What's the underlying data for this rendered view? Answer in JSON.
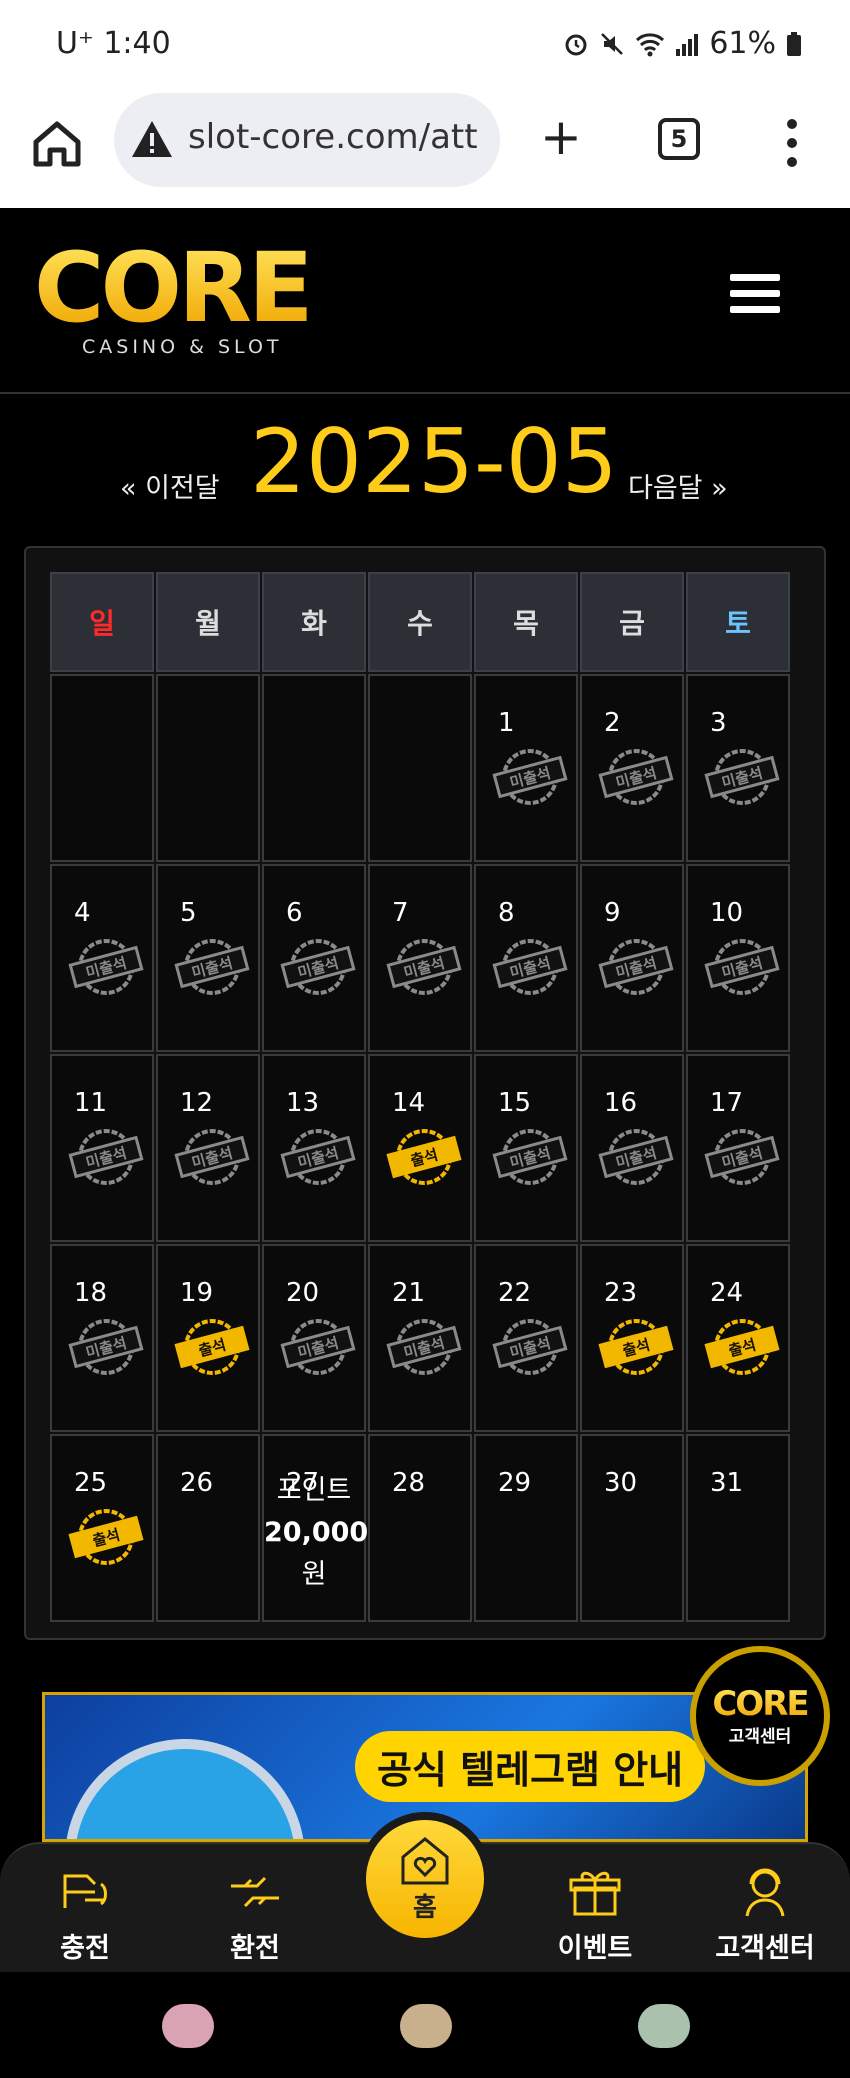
{
  "status": {
    "carrier_time": "U⁺ 1:40",
    "battery": "61%"
  },
  "browser": {
    "url": "slot-core.com/att",
    "tab_count": "5"
  },
  "site": {
    "logo_text": "CORE",
    "logo_sub": "CASINO & SLOT",
    "prev_label": "« 이전달",
    "month": "2025-05",
    "next_label": "다음달 »"
  },
  "calendar": {
    "weekdays": [
      "일",
      "월",
      "화",
      "수",
      "목",
      "금",
      "토"
    ],
    "weekday_colors": [
      "#ff2a2a",
      "#dddddd",
      "#dddddd",
      "#dddddd",
      "#dddddd",
      "#dddddd",
      "#6cc3ff"
    ],
    "stamp_labels": {
      "absent": "미출석",
      "present": "출석"
    },
    "weeks": [
      [
        null,
        null,
        null,
        null,
        {
          "day": "1",
          "status": "absent"
        },
        {
          "day": "2",
          "status": "absent"
        },
        {
          "day": "3",
          "status": "absent"
        }
      ],
      [
        {
          "day": "4",
          "status": "absent"
        },
        {
          "day": "5",
          "status": "absent"
        },
        {
          "day": "6",
          "status": "absent"
        },
        {
          "day": "7",
          "status": "absent"
        },
        {
          "day": "8",
          "status": "absent"
        },
        {
          "day": "9",
          "status": "absent"
        },
        {
          "day": "10",
          "status": "absent"
        }
      ],
      [
        {
          "day": "11",
          "status": "absent"
        },
        {
          "day": "12",
          "status": "absent"
        },
        {
          "day": "13",
          "status": "absent"
        },
        {
          "day": "14",
          "status": "present"
        },
        {
          "day": "15",
          "status": "absent"
        },
        {
          "day": "16",
          "status": "absent"
        },
        {
          "day": "17",
          "status": "absent"
        }
      ],
      [
        {
          "day": "18",
          "status": "absent"
        },
        {
          "day": "19",
          "status": "present"
        },
        {
          "day": "20",
          "status": "absent"
        },
        {
          "day": "21",
          "status": "absent"
        },
        {
          "day": "22",
          "status": "absent"
        },
        {
          "day": "23",
          "status": "present"
        },
        {
          "day": "24",
          "status": "present"
        }
      ],
      [
        {
          "day": "25",
          "status": "present"
        },
        {
          "day": "26",
          "status": null
        },
        {
          "day": "27",
          "status": "reward",
          "reward_lines": [
            "포인트",
            "20,000",
            "원"
          ]
        },
        {
          "day": "28",
          "status": null
        },
        {
          "day": "29",
          "status": null
        },
        {
          "day": "30",
          "status": null
        },
        {
          "day": "31",
          "status": null
        }
      ]
    ]
  },
  "banner": {
    "text": "공식 텔레그램 안내"
  },
  "cs_badge": {
    "logo": "CORE",
    "label": "고객센터"
  },
  "tabbar": {
    "items": [
      {
        "label": "충전",
        "icon": "charge-icon"
      },
      {
        "label": "환전",
        "icon": "exchange-icon"
      },
      {
        "label": "홈",
        "icon": "home-heart-icon"
      },
      {
        "label": "이벤트",
        "icon": "gift-icon"
      },
      {
        "label": "고객센터",
        "icon": "support-icon"
      }
    ]
  },
  "colors": {
    "accent": "#ffcc1a",
    "absent_stamp": "#8a8a8a",
    "present_stamp": "#f2b800"
  }
}
